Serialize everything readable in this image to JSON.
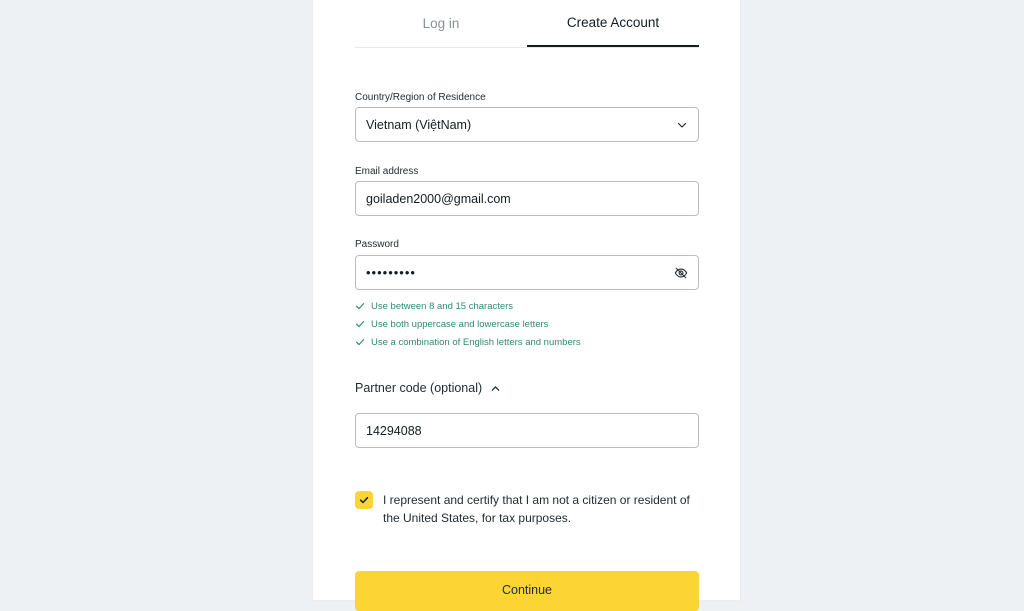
{
  "tabs": [
    {
      "label": "Log in",
      "active": false
    },
    {
      "label": "Create Account",
      "active": true
    }
  ],
  "country": {
    "label": "Country/Region of Residence",
    "value": "Vietnam (ViệtNam)"
  },
  "email": {
    "label": "Email address",
    "value": "goiladen2000@gmail.com"
  },
  "password": {
    "label": "Password",
    "masked_value": "•••••••••",
    "rules": [
      "Use between 8 and 15 characters",
      "Use both uppercase and lowercase letters",
      "Use a combination of English letters and numbers"
    ]
  },
  "partner": {
    "label": "Partner code (optional)",
    "value": "14294088"
  },
  "consent": {
    "checked": true,
    "text": "I represent and certify that I am not a citizen or resident of the United States, for tax purposes."
  },
  "continue_label": "Continue",
  "colors": {
    "accent": "#fcd535",
    "rule_ok": "#2f8a73",
    "background": "#edf1f4"
  },
  "icons": {
    "country_dropdown": "chevron-down-icon",
    "password_visibility": "eye-off-icon",
    "partner_toggle": "chevron-up-icon",
    "rule_status": "check-icon",
    "consent_check": "check-icon"
  }
}
